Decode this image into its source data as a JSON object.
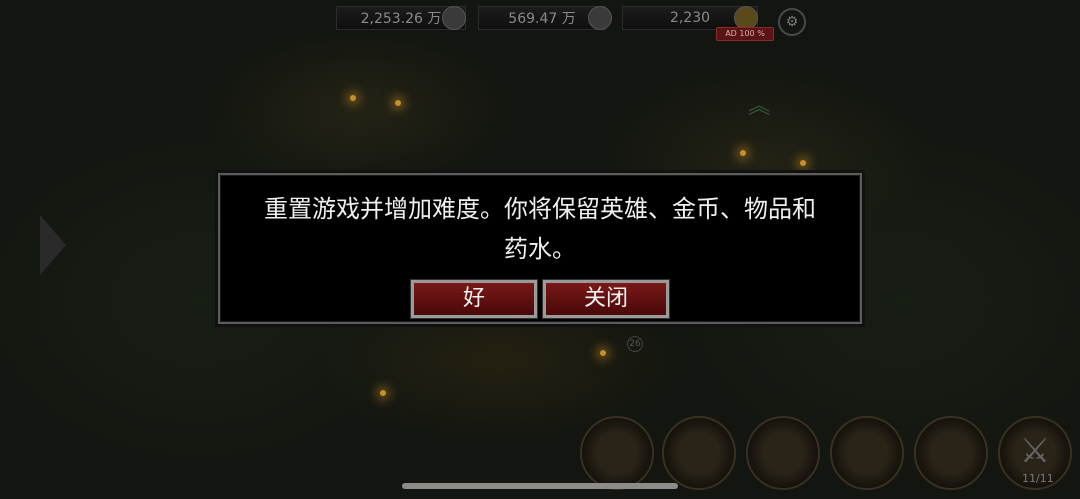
{
  "resources": {
    "gold": "2,253.26 万",
    "silver": "569.47 万",
    "gems": "2,230",
    "ad_badge": "AD 100 %"
  },
  "dialog": {
    "message_line1": "重置游戏并增加难度。你将保留英雄、金币、物品和",
    "message_line2": "药水。",
    "ok_label": "好",
    "close_label": "关闭"
  },
  "map": {
    "marker_label": "26"
  },
  "footer": {
    "hero_count": "11/11"
  }
}
